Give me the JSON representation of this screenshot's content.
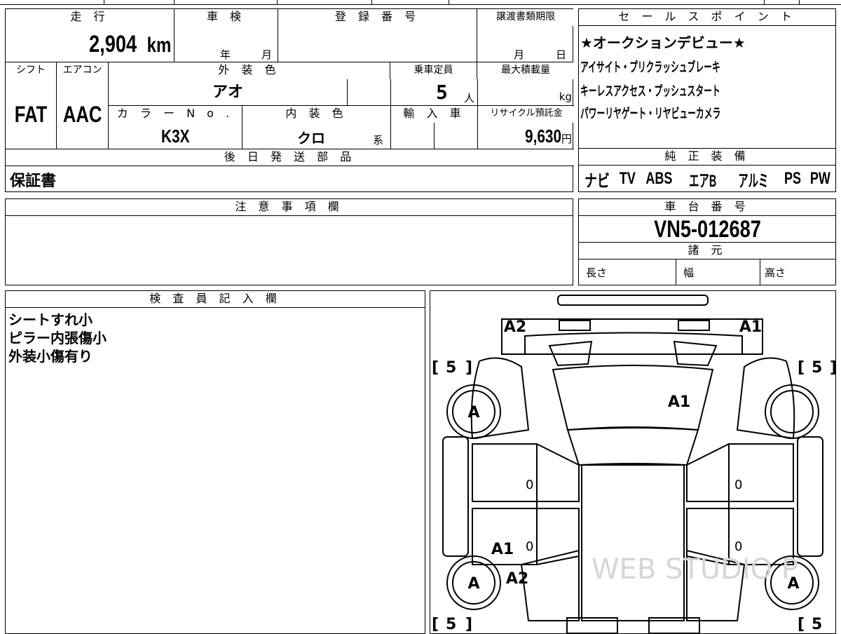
{
  "main_table": {
    "headers": {
      "mileage": "走 行",
      "inspection": "車 検",
      "registration_number": "登 録 番 号",
      "transfer_deadline": "譲渡書類期限",
      "shift": "シフト",
      "aircon": "エアコン",
      "exterior_color": "外 装 色",
      "seating_capacity": "乗車定員",
      "max_load": "最大積載量",
      "color_no": "カ ラ ー N o .",
      "interior_color": "内 装 色",
      "import": "輸 入 車",
      "recycle_fee": "リサイクル預託金",
      "later_parts": "後 日 発 送 部 品"
    },
    "values": {
      "mileage": "2,904",
      "mileage_unit": "km",
      "inspection_year": "年",
      "inspection_month": "月",
      "deadline_month": "月",
      "deadline_day": "日",
      "shift": "FAT",
      "aircon": "AAC",
      "exterior_color": "アオ",
      "seating_capacity": "5",
      "seating_unit": "人",
      "max_load_unit": "kg",
      "color_no": "K3X",
      "interior_color": "クロ",
      "interior_suffix": "系",
      "recycle_fee": "9,630",
      "recycle_unit": "円",
      "later_parts": "保証書"
    }
  },
  "sales_points": {
    "header": "セ ー ル ス ポ イ ン ト",
    "lines": [
      "★オークションデビュー★",
      "アイサイト・プリクラッシュブレーキ",
      "キーレスアクセス・プッシュスタート",
      "パワーリヤゲート・リヤビューカメラ"
    ]
  },
  "equipment": {
    "header": "純 正 装 備",
    "items": [
      "ナビ",
      "TV",
      "ABS",
      "エアB",
      "アルミ",
      "PS",
      "PW"
    ]
  },
  "notes": {
    "header": "注 意 事 項 欄"
  },
  "chassis": {
    "header": "車 台 番 号",
    "number": "VN5-012687"
  },
  "specs": {
    "header": "諸 元",
    "length": "長さ",
    "width": "幅",
    "height": "高さ"
  },
  "inspector": {
    "header": "検 査 員 記 入 欄",
    "lines": [
      "シートすれ小",
      "ピラー内張傷小",
      "外装小傷有り"
    ]
  },
  "diagram": {
    "marks": {
      "front_left": "A2",
      "front_right": "A1",
      "hood": "A1",
      "rear_left_panel_1": "A1",
      "rear_left_panel_2": "A2",
      "tire": "A",
      "tread": "5",
      "door": "0"
    },
    "watermark": "WEB STUDIO P"
  }
}
